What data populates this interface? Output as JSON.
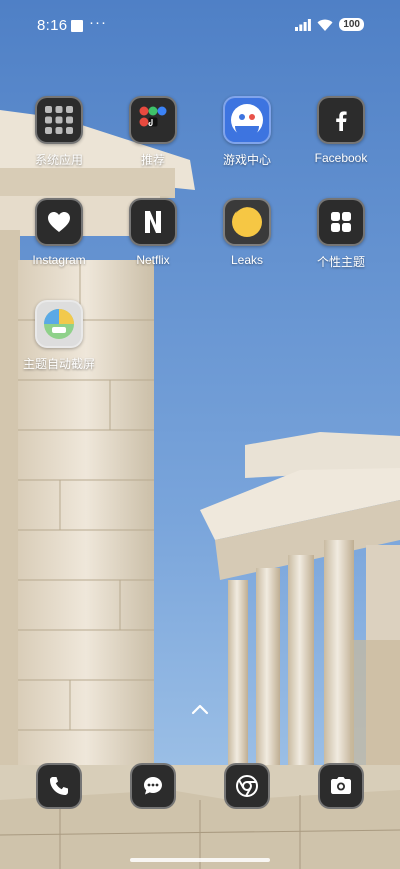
{
  "status_bar": {
    "time": "8:16",
    "overflow": "···",
    "battery": "100"
  },
  "apps": [
    {
      "label": "系统应用",
      "icon": "folder-grid-icon"
    },
    {
      "label": "推荐",
      "icon": "folder-apps-icon"
    },
    {
      "label": "游戏中心",
      "icon": "game-center-icon"
    },
    {
      "label": "Facebook",
      "icon": "facebook-icon"
    },
    {
      "label": "Instagram",
      "icon": "heart-icon"
    },
    {
      "label": "Netflix",
      "icon": "netflix-icon"
    },
    {
      "label": "Leaks",
      "icon": "leaks-icon"
    },
    {
      "label": "个性主题",
      "icon": "themes-grid-icon"
    },
    {
      "label": "主题自动截屏",
      "icon": "screenshot-theme-icon"
    }
  ],
  "dock": [
    {
      "name": "phone",
      "icon": "phone-icon"
    },
    {
      "name": "messages",
      "icon": "message-icon"
    },
    {
      "name": "browser",
      "icon": "chrome-icon"
    },
    {
      "name": "camera",
      "icon": "camera-icon"
    }
  ],
  "colors": {
    "sky_top": "#4f80c6",
    "sky_bottom": "#9ec3ea",
    "stone": "#e8e0d2",
    "icon_bg": "#2c2c2c"
  }
}
